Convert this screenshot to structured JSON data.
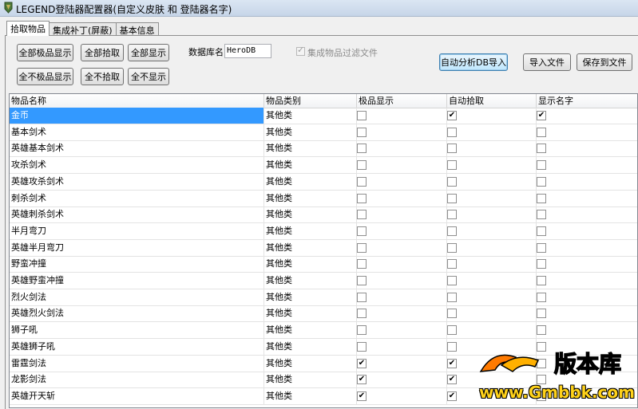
{
  "window": {
    "title": "LEGEND登陆器配置器(自定义皮肤 和 登陆器名字)"
  },
  "tabs": [
    {
      "label": "拾取物品",
      "active": true
    },
    {
      "label": "集成补丁(屏蔽)",
      "active": false
    },
    {
      "label": "基本信息",
      "active": false
    }
  ],
  "toolbar": {
    "all_fine_show": "全部极品显示",
    "all_pickup": "全部拾取",
    "all_show": "全部显示",
    "none_fine_show": "全不极品显示",
    "none_pickup": "全不拾取",
    "none_show": "全不显示",
    "db_label": "数据库名",
    "db_value": "HeroDB",
    "filter_label": "集成物品过滤文件",
    "auto_import": "自动分析DB导入",
    "import_file": "导入文件",
    "save_file": "保存到文件"
  },
  "table": {
    "columns": [
      "物品名称",
      "物品类别",
      "极品显示",
      "自动拾取",
      "显示名字"
    ],
    "rows": [
      {
        "name": "金币",
        "type": "其他类",
        "fine": false,
        "pickup": true,
        "showname": true,
        "selected": true
      },
      {
        "name": "基本剑术",
        "type": "其他类",
        "fine": false,
        "pickup": false,
        "showname": false
      },
      {
        "name": "英雄基本剑术",
        "type": "其他类",
        "fine": false,
        "pickup": false,
        "showname": false
      },
      {
        "name": "攻杀剑术",
        "type": "其他类",
        "fine": false,
        "pickup": false,
        "showname": false
      },
      {
        "name": "英雄攻杀剑术",
        "type": "其他类",
        "fine": false,
        "pickup": false,
        "showname": false
      },
      {
        "name": "刺杀剑术",
        "type": "其他类",
        "fine": false,
        "pickup": false,
        "showname": false
      },
      {
        "name": "英雄刺杀剑术",
        "type": "其他类",
        "fine": false,
        "pickup": false,
        "showname": false
      },
      {
        "name": "半月弯刀",
        "type": "其他类",
        "fine": false,
        "pickup": false,
        "showname": false
      },
      {
        "name": "英雄半月弯刀",
        "type": "其他类",
        "fine": false,
        "pickup": false,
        "showname": false
      },
      {
        "name": "野蛮冲撞",
        "type": "其他类",
        "fine": false,
        "pickup": false,
        "showname": false
      },
      {
        "name": "英雄野蛮冲撞",
        "type": "其他类",
        "fine": false,
        "pickup": false,
        "showname": false
      },
      {
        "name": "烈火剑法",
        "type": "其他类",
        "fine": false,
        "pickup": false,
        "showname": false
      },
      {
        "name": "英雄烈火剑法",
        "type": "其他类",
        "fine": false,
        "pickup": false,
        "showname": false
      },
      {
        "name": "狮子吼",
        "type": "其他类",
        "fine": false,
        "pickup": false,
        "showname": false
      },
      {
        "name": "英雄狮子吼",
        "type": "其他类",
        "fine": false,
        "pickup": false,
        "showname": false
      },
      {
        "name": "雷霆剑法",
        "type": "其他类",
        "fine": true,
        "pickup": true,
        "showname": false
      },
      {
        "name": "龙影剑法",
        "type": "其他类",
        "fine": true,
        "pickup": true,
        "showname": false
      },
      {
        "name": "英雄开天斩",
        "type": "其他类",
        "fine": true,
        "pickup": true,
        "showname": false
      }
    ]
  },
  "watermark": {
    "brand": "版本库",
    "url": "www.Gmbbk.com"
  }
}
